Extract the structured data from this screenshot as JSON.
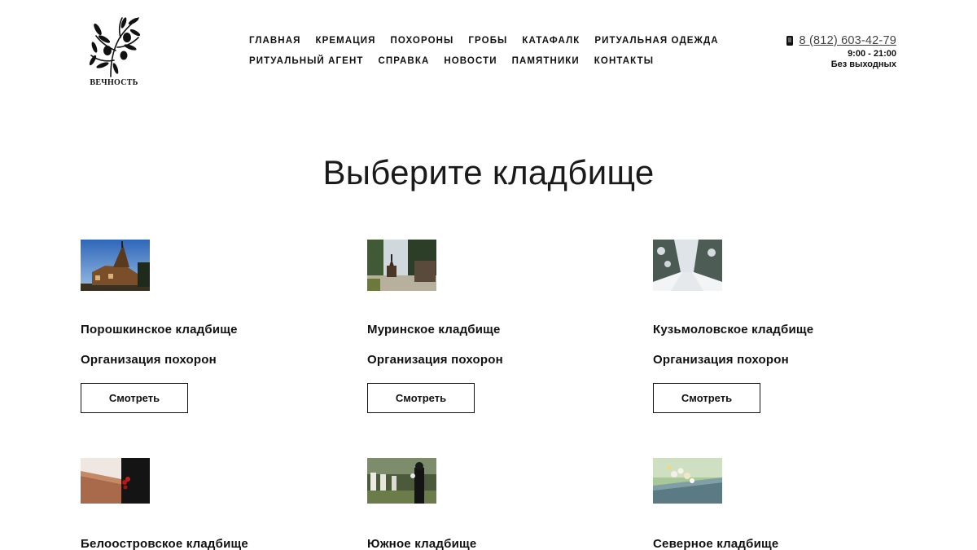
{
  "header": {
    "logo_text": "ВЕЧНОСТЬ",
    "nav_row1": [
      "ГЛАВНАЯ",
      "КРЕМАЦИЯ",
      "ПОХОРОНЫ",
      "ГРОБЫ",
      "КАТАФАЛК",
      "РИТУАЛЬНАЯ ОДЕЖДА"
    ],
    "nav_row2": [
      "РИТУАЛЬНЫЙ АГЕНТ",
      "СПРАВКА",
      "НОВОСТИ",
      "ПАМЯТНИКИ",
      "КОНТАКТЫ"
    ],
    "phone": "8 (812) 603-42-79",
    "hours": "9:00 - 21:00",
    "days": "Без выходных",
    "phone_icon": "mobile-phone-icon"
  },
  "main": {
    "title": "Выберите кладбище",
    "cemeteries": [
      {
        "name": "Порошкинское кладбище",
        "subtitle": "Организация похорон",
        "button": "Смотреть",
        "image": "wooden-church-photo"
      },
      {
        "name": "Муринское кладбище",
        "subtitle": "Организация похорон",
        "button": "Смотреть",
        "image": "chapel-in-trees-photo"
      },
      {
        "name": "Кузьмоловское кладбище",
        "subtitle": "Организация похорон",
        "button": "Смотреть",
        "image": "snowy-alley-photo"
      },
      {
        "name": "Белоостровское кладбище",
        "image": "coffin-with-roses-photo"
      },
      {
        "name": "Южное кладбище",
        "image": "mourner-at-graves-photo"
      },
      {
        "name": "Северное кладбище",
        "image": "flowers-on-coffin-photo"
      }
    ]
  },
  "colors": {
    "text": "#111111",
    "phone_link": "#444444",
    "background": "#ffffff"
  }
}
